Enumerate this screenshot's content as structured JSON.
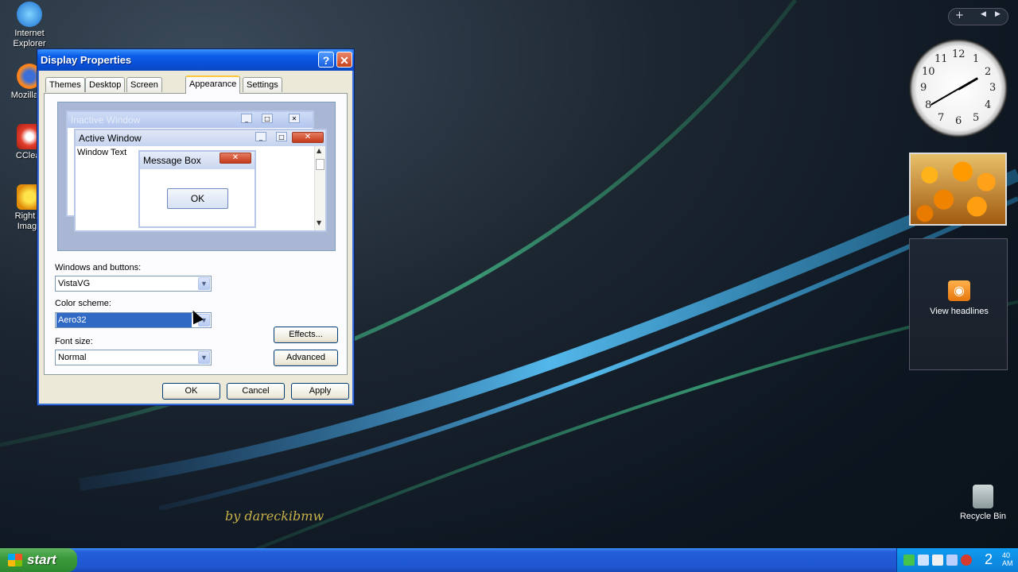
{
  "desktop": {
    "icons": [
      {
        "label_line1": "Internet",
        "label_line2": "Explorer",
        "icon": "internet-explorer-icon"
      },
      {
        "label_line1": "Mozilla Fi",
        "label_line2": "",
        "icon": "firefox-icon"
      },
      {
        "label_line1": "CClear",
        "label_line2": "",
        "icon": "ccleaner-icon"
      },
      {
        "label_line1": "Right C",
        "label_line2": "Image",
        "icon": "image-tool-icon"
      }
    ],
    "recycle_bin": "Recycle Bin",
    "watermark": "by dareckibmw"
  },
  "dialog": {
    "title": "Display Properties",
    "help_glyph": "?",
    "close_glyph": "✕",
    "tabs": [
      "Themes",
      "Desktop",
      "Screen Saver",
      "Appearance",
      "Settings"
    ],
    "active_tab": "Appearance",
    "preview": {
      "inactive_title": "Inactive Window",
      "active_title": "Active Window",
      "window_text": "Window Text",
      "message_title": "Message Box",
      "message_ok": "OK"
    },
    "windows_buttons_label": "Windows and buttons:",
    "windows_buttons_value": "VistaVG",
    "color_scheme_label": "Color scheme:",
    "color_scheme_value": "Aero32",
    "font_size_label": "Font size:",
    "font_size_value": "Normal",
    "effects_button": "Effects...",
    "advanced_button": "Advanced",
    "ok_button": "OK",
    "cancel_button": "Cancel",
    "apply_button": "Apply"
  },
  "sidebar": {
    "plus_glyph": "+",
    "clock_numbers": [
      "12",
      "1",
      "2",
      "3",
      "4",
      "5",
      "6",
      "7",
      "8",
      "9",
      "10",
      "11"
    ],
    "news_label": "View headlines"
  },
  "taskbar": {
    "start_label": "start",
    "time_hour": "2",
    "time_min": "40",
    "time_ampm": "AM"
  },
  "colors": {
    "xp_blue": "#245edb",
    "start_green": "#3c9a3c",
    "selection": "#316ac5"
  }
}
